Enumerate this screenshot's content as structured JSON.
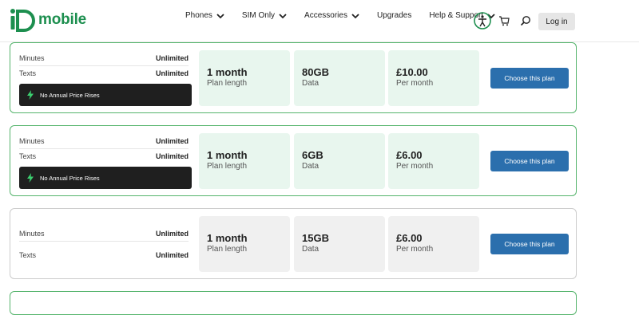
{
  "brand": {
    "logo_text": "mobile"
  },
  "nav": {
    "items": [
      {
        "label": "Phones",
        "dropdown": true
      },
      {
        "label": "SIM Only",
        "dropdown": true
      },
      {
        "label": "Accessories",
        "dropdown": true
      },
      {
        "label": "Upgrades",
        "dropdown": false
      },
      {
        "label": "Help & Support",
        "dropdown": true
      }
    ],
    "login_label": "Log in"
  },
  "plans": [
    {
      "minutes_label": "Minutes",
      "minutes_value": "Unlimited",
      "texts_label": "Texts",
      "texts_value": "Unlimited",
      "badge": "No Annual Price Rises",
      "length_value": "1 month",
      "length_label": "Plan length",
      "data_value": "80GB",
      "data_label": "Data",
      "price_value": "£10.00",
      "price_label": "Per month",
      "button": "Choose this plan",
      "style": "green"
    },
    {
      "minutes_label": "Minutes",
      "minutes_value": "Unlimited",
      "texts_label": "Texts",
      "texts_value": "Unlimited",
      "badge": "No Annual Price Rises",
      "length_value": "1 month",
      "length_label": "Plan length",
      "data_value": "6GB",
      "data_label": "Data",
      "price_value": "£6.00",
      "price_label": "Per month",
      "button": "Choose this plan",
      "style": "green"
    },
    {
      "minutes_label": "Minutes",
      "minutes_value": "Unlimited",
      "texts_label": "Texts",
      "texts_value": "Unlimited",
      "length_value": "1 month",
      "length_label": "Plan length",
      "data_value": "15GB",
      "data_label": "Data",
      "price_value": "£6.00",
      "price_label": "Per month",
      "button": "Choose this plan",
      "style": "grey"
    }
  ],
  "colors": {
    "brand_green": "#1d8f4f",
    "card_border_green": "#55b46c",
    "button_blue": "#2b6fad",
    "badge_dark": "#1f1f1f",
    "bolt_green": "#3cd070"
  },
  "icons": [
    "chevron-down-icon",
    "accessibility-icon",
    "cart-icon",
    "search-icon",
    "bolt-icon"
  ]
}
